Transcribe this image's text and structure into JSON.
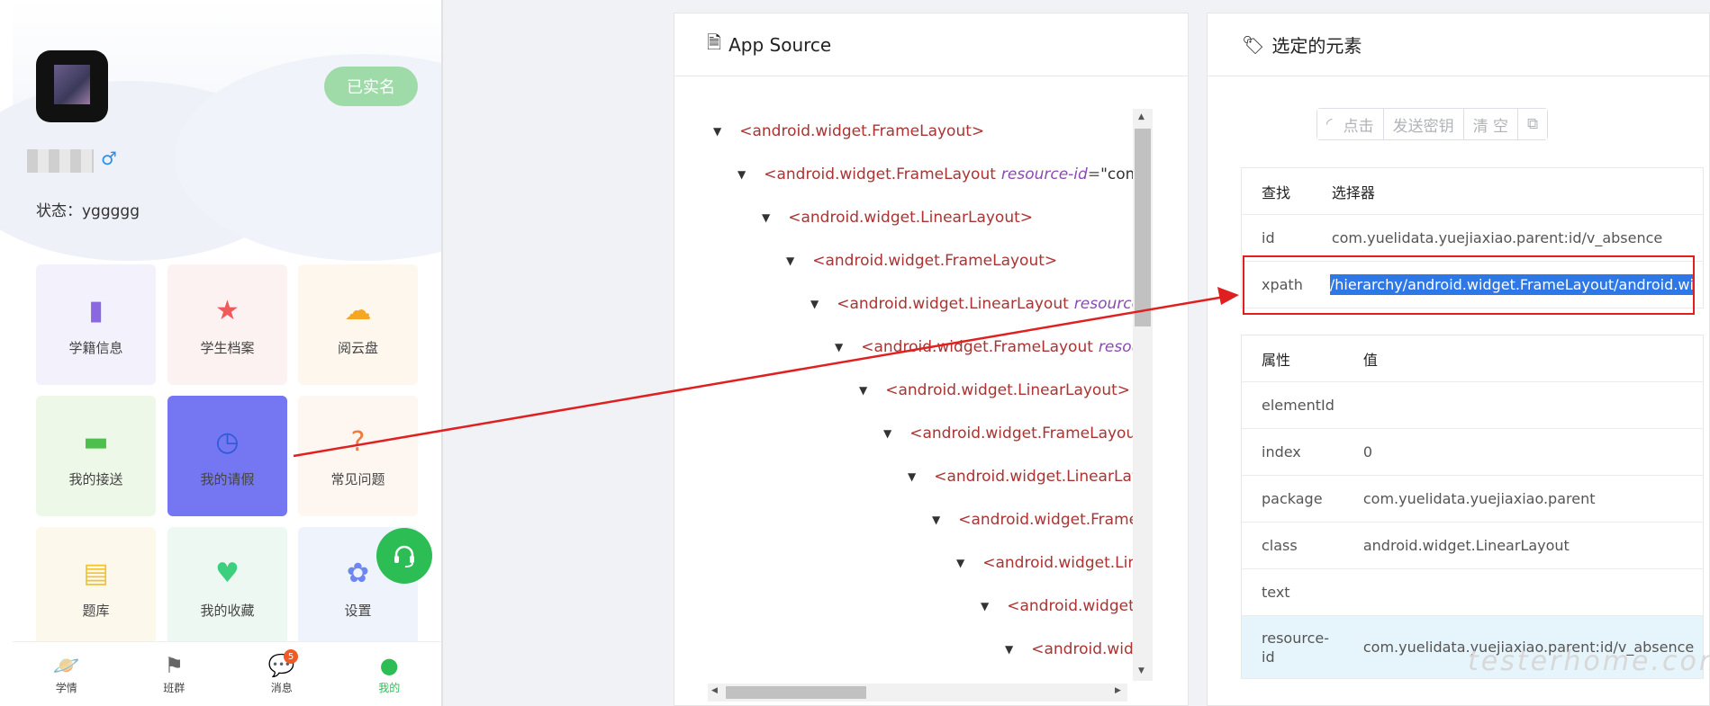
{
  "phone": {
    "verified_label": "已实名",
    "gender_symbol": "♂",
    "status_text": "状态：yggggg",
    "tiles": [
      {
        "label": "学籍信息",
        "icon": "id-book-icon",
        "bg": "#f3f1fc",
        "color": "#8a68e0"
      },
      {
        "label": "学生档案",
        "icon": "star-icon",
        "bg": "#fdf2f2",
        "color": "#ef5a5a"
      },
      {
        "label": "阅云盘",
        "icon": "cloud-icon",
        "bg": "#fdf7ee",
        "color": "#f5a623"
      },
      {
        "label": "我的接送",
        "icon": "bus-icon",
        "bg": "#eef8e8",
        "color": "#4cbf4c"
      },
      {
        "label": "我的请假",
        "icon": "clock-icon",
        "bg": "#7476f2",
        "color": "#2d5bd7"
      },
      {
        "label": "常见问题",
        "icon": "question-icon",
        "bg": "#fdf6f1",
        "color": "#f07a3a"
      },
      {
        "label": "题库",
        "icon": "question-bank-icon",
        "bg": "#fdf8ec",
        "color": "#f2c230"
      },
      {
        "label": "我的收藏",
        "icon": "heart-icon",
        "bg": "#eef8f3",
        "color": "#3ccf7e"
      },
      {
        "label": "设置",
        "icon": "gear-icon",
        "bg": "#eef3fc",
        "color": "#6e86ef"
      }
    ],
    "tabs": [
      {
        "label": "学情",
        "icon": "planet-icon"
      },
      {
        "label": "班群",
        "icon": "bookmark-icon"
      },
      {
        "label": "消息",
        "icon": "message-icon",
        "badge": "5"
      },
      {
        "label": "我的",
        "icon": "user-icon",
        "active": true
      }
    ]
  },
  "source": {
    "title": "App Source",
    "nodes": [
      {
        "tag": "<android.widget.FrameLayout>"
      },
      {
        "tag": "<android.widget.FrameLayout",
        "attr": "resource-id",
        "eq": "=",
        "val": "\"com.yu"
      },
      {
        "tag": "<android.widget.LinearLayout>"
      },
      {
        "tag": "<android.widget.FrameLayout>"
      },
      {
        "tag": "<android.widget.LinearLayout",
        "attr": "resource-id"
      },
      {
        "tag": "<android.widget.FrameLayout",
        "attr": "resource"
      },
      {
        "tag": "<android.widget.LinearLayout>"
      },
      {
        "tag": "<android.widget.FrameLayout>"
      },
      {
        "tag": "<android.widget.LinearLayo"
      },
      {
        "tag": "<android.widget.FrameL"
      },
      {
        "tag": "<android.widget.Line"
      },
      {
        "tag": "<android.widget."
      },
      {
        "tag": "<android.wide"
      }
    ]
  },
  "selected": {
    "title": "选定的元素",
    "buttons": [
      "点击",
      "发送密钥",
      "清 空"
    ],
    "find_header": [
      "查找",
      "选择器"
    ],
    "find_rows": [
      {
        "key": "id",
        "value": "com.yuelidata.yuejiaxiao.parent:id/v_absence"
      },
      {
        "key": "xpath",
        "value": "/hierarchy/android.widget.FrameLayout/android.wi"
      }
    ],
    "attr_header": [
      "属性",
      "值"
    ],
    "attr_rows": [
      {
        "key": "elementId",
        "value": ""
      },
      {
        "key": "index",
        "value": "0"
      },
      {
        "key": "package",
        "value": "com.yuelidata.yuejiaxiao.parent"
      },
      {
        "key": "class",
        "value": "android.widget.LinearLayout"
      },
      {
        "key": "text",
        "value": ""
      },
      {
        "key": "resource-id",
        "value": "com.yuelidata.yuejiaxiao.parent:id/v_absence",
        "highlight": true
      }
    ]
  },
  "watermark": "testerhome.com"
}
